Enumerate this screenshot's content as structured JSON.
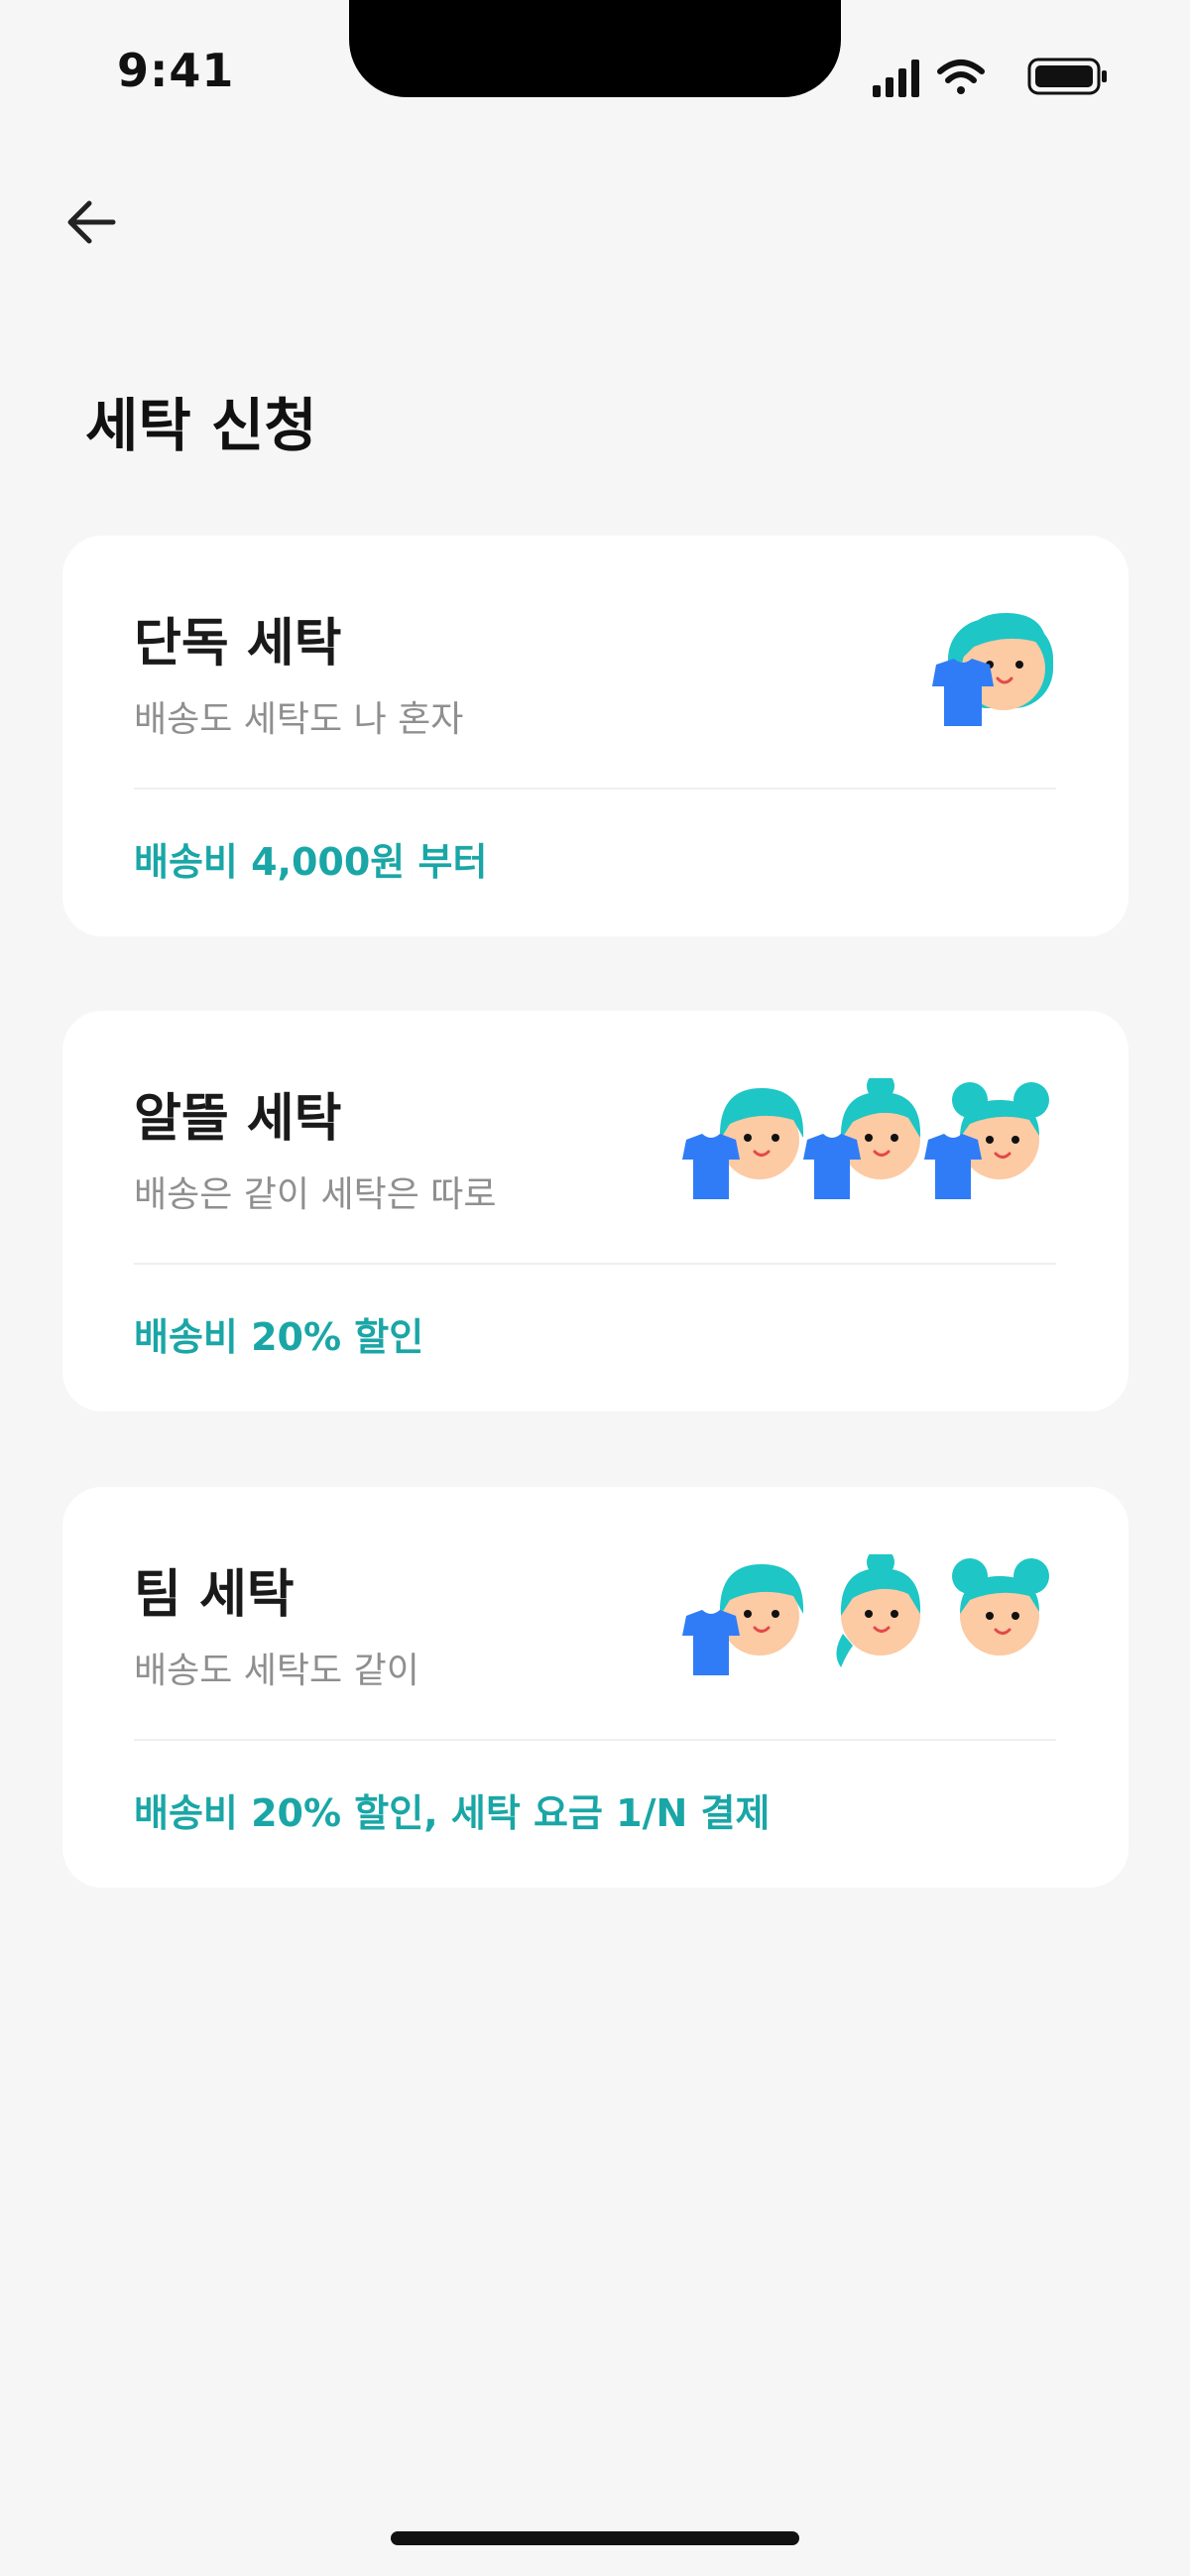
{
  "status_bar": {
    "time": "9:41"
  },
  "header": {
    "title": "세탁 신청"
  },
  "cards": [
    {
      "title": "단독 세탁",
      "subtitle": "배송도 세탁도 나 혼자",
      "price": "배송비 4,000원 부터"
    },
    {
      "title": "알뜰 세탁",
      "subtitle": "배송은 같이 세탁은 따로",
      "price": "배송비 20% 할인"
    },
    {
      "title": "팀 세탁",
      "subtitle": "배송도 세탁도 같이",
      "price": "배송비 20% 할인, 세탁 요금 1/N 결제"
    }
  ],
  "colors": {
    "accent": "#1aa6a6",
    "hair": "#1ec6c6",
    "face": "#fccaa3",
    "shirt": "#2f7cf6",
    "background": "#f6f6f6"
  },
  "icons": {
    "back": "arrow-left-icon",
    "signal": "cellular-signal-icon",
    "wifi": "wifi-icon",
    "battery": "battery-icon"
  }
}
